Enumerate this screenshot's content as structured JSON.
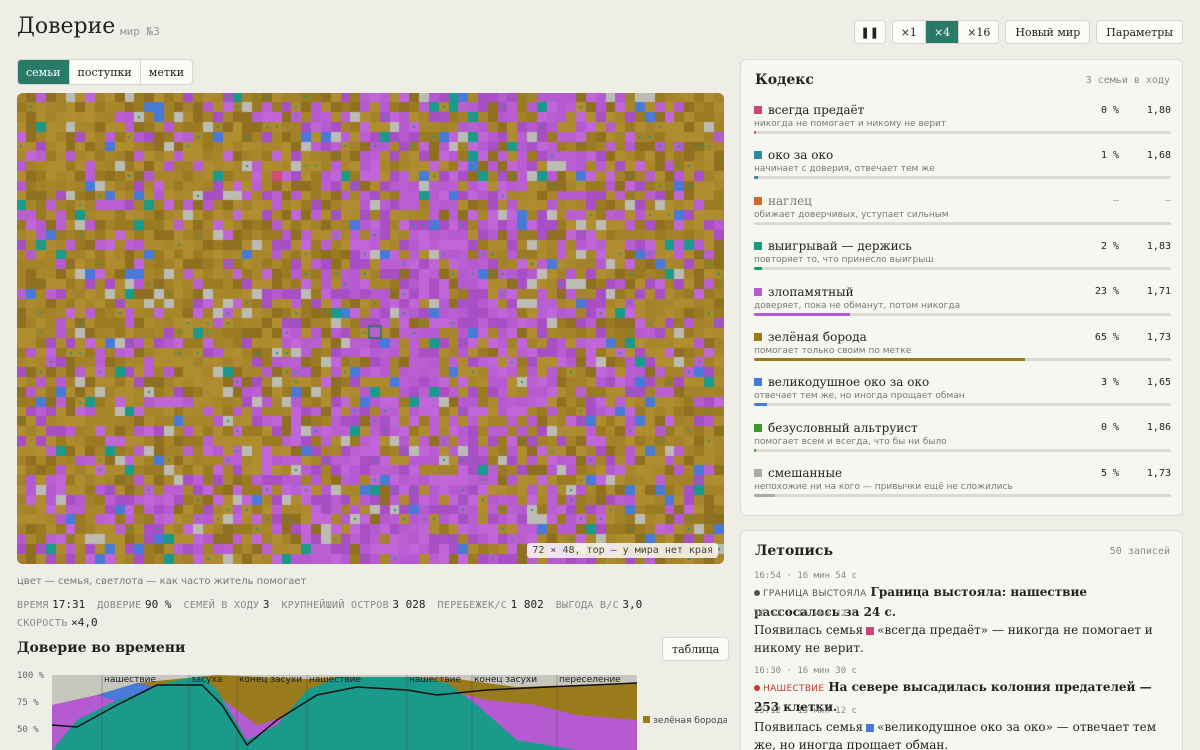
{
  "header": {
    "title": "Доверие",
    "world": "мир №3",
    "pause_label": "❚❚",
    "speeds": [
      "×1",
      "×4",
      "×16"
    ],
    "active_speed": "×4",
    "new_world_label": "Новый мир",
    "settings_label": "Параметры"
  },
  "view_tabs": [
    "семьи",
    "поступки",
    "метки"
  ],
  "map": {
    "caption": "72 × 48, тор — у мира нет края",
    "legend_note": "цвет — семья, светлота — как часто житель помогает"
  },
  "stats": [
    {
      "label": "ВРЕМЯ",
      "value": "17:31"
    },
    {
      "label": "ДОВЕРИЕ",
      "value": "90 %"
    },
    {
      "label": "СЕМЕЙ В ХОДУ",
      "value": "3"
    },
    {
      "label": "КРУПНЕЙШИЙ ОСТРОВ",
      "value": "3 028"
    },
    {
      "label": "ПЕРЕБЕЖЕК/С",
      "value": "1 802"
    },
    {
      "label": "ВЫГОДА В/С",
      "value": "3,0"
    },
    {
      "label": "СКОРОСТЬ",
      "value": "×4,0"
    }
  ],
  "trust_chart": {
    "title": "Доверие во времени",
    "table_label": "таблица",
    "y_ticks": [
      "100 %",
      "75 %",
      "50 %"
    ],
    "events": [
      "нашествие",
      "засуха",
      "конец засухи",
      "нашествие",
      "нашествие",
      "конец засухи",
      "переселение"
    ],
    "legend_label": "зелёная борода",
    "legend_color": "#9a7b1c"
  },
  "chart_data": {
    "type": "area",
    "title": "Доверие во времени",
    "y_unit": "%",
    "ylim": [
      0,
      100
    ],
    "series": [
      {
        "name": "зелёная борода",
        "color": "#9a7b1c"
      }
    ]
  },
  "codex": {
    "title": "Кодекс",
    "meta": "3 семьи в ходу",
    "strategies": [
      {
        "name": "всегда предаёт",
        "color": "#c9457a",
        "pct": "0 %",
        "share": 0.005,
        "score": "1,80",
        "desc": "никогда не помогает и никому не верит"
      },
      {
        "name": "око за око",
        "color": "#2a8aa0",
        "pct": "1 %",
        "share": 0.01,
        "score": "1,68",
        "desc": "начинает с доверия, отвечает тем же"
      },
      {
        "name": "наглец",
        "color": "#d06a2a",
        "pct": "—",
        "share": 0,
        "score": "—",
        "desc": "обижает доверчивых, уступает сильным"
      },
      {
        "name": "выигрывай — держись",
        "color": "#1a9a7a",
        "pct": "2 %",
        "share": 0.02,
        "score": "1,83",
        "desc": "повторяет то, что принесло выигрыш"
      },
      {
        "name": "злопамятный",
        "color": "#b55ad0",
        "pct": "23 %",
        "share": 0.23,
        "score": "1,71",
        "desc": "доверяет, пока не обманут, потом никогда"
      },
      {
        "name": "зелёная борода",
        "color": "#9a7b1c",
        "pct": "65 %",
        "share": 0.65,
        "score": "1,73",
        "desc": "помогает только своим по метке"
      },
      {
        "name": "великодушное око за око",
        "color": "#4a7ad8",
        "pct": "3 %",
        "share": 0.03,
        "score": "1,65",
        "desc": "отвечает тем же, но иногда прощает обман"
      },
      {
        "name": "безусловный альтруист",
        "color": "#3a9a2a",
        "pct": "0 %",
        "share": 0.004,
        "score": "1,86",
        "desc": "помогает всем и всегда, что бы ни было"
      },
      {
        "name": "смешанные",
        "color": "#aaaaaa",
        "pct": "5 %",
        "share": 0.05,
        "score": "1,73",
        "desc": "непохожие ни на кого — привычки ещё не сложились"
      }
    ]
  },
  "chronicle": {
    "title": "Летопись",
    "meta": "50 записей",
    "entries": [
      {
        "time": "16:54 · 16 мин 54 с",
        "tag": "ГРАНИЦА ВЫСТОЯЛА",
        "tag_color": "#555555",
        "text": "Граница выстояла: нашествие рассосалось за 24 с.",
        "bold": true
      },
      {
        "time": "16:42 · 16 мин 42 с",
        "tag": "",
        "swatch": "#c9457a",
        "before": "Появилась семья",
        "text": "«всегда предаёт» — никогда не помогает и никому не верит.",
        "bold": false
      },
      {
        "time": "16:30 · 16 мин 30 с",
        "tag": "НАШЕСТВИЕ",
        "tag_color": "#c0392b",
        "text": "На севере высадилась колония предателей — 253 клетки.",
        "bold": true
      },
      {
        "time": "15:12 · 15 мин 12 с",
        "tag": "",
        "swatch": "#4a7ad8",
        "before": "Появилась семья",
        "text": "«великодушное око за око» — отвечает тем же, но иногда прощает обман.",
        "bold": false
      }
    ]
  }
}
